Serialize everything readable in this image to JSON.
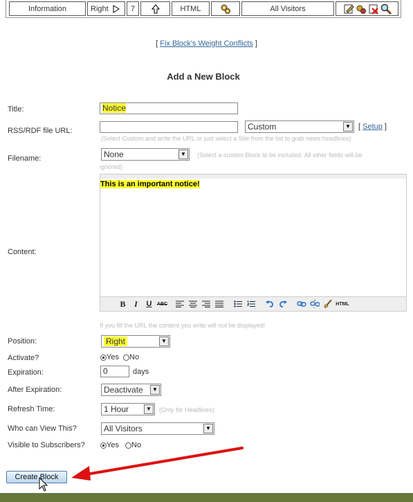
{
  "top_bar": {
    "information": "Information",
    "position": "Right",
    "weight": "7",
    "type": "HTML",
    "who": "All Visitors"
  },
  "fix_link": "Fix Block's Weight Conflicts",
  "heading": "Add a New Block",
  "fields": {
    "title_label": "Title:",
    "title_value": "Notice",
    "rss_label": "RSS/RDF file URL:",
    "rss_value": "",
    "rss_select": "Custom",
    "setup_link": "Setup",
    "rss_hint": "(Select Custom and write the URL or just select a Site from the list to grab news headlines)",
    "filename_label": "Filename:",
    "filename_value": "None",
    "filename_hint_1": "(Select a custom Block to be included. All other fields will be",
    "filename_hint_2": "ignored)",
    "content_label": "Content:",
    "content_value": "This is an important notice!",
    "content_hint": "If you fill the URL the content you write will not be displayed!",
    "position_label": "Position:",
    "position_value": "Right",
    "activate_label": "Activate?",
    "yes": "Yes",
    "no": "No",
    "expiration_label": "Expiration:",
    "expiration_value": "0",
    "expiration_unit": "days",
    "after_exp_label": "After Expiration:",
    "after_exp_value": "Deactivate",
    "refresh_label": "Refresh Time:",
    "refresh_value": "1 Hour",
    "refresh_hint": "(Only for Headlines)",
    "who_label": "Who can View This?",
    "who_value": "All Visitors",
    "visible_label": "Visible to Subscribers?"
  },
  "toolbar": {
    "bold": "B",
    "italic": "I",
    "underline": "U",
    "strike": "ABC",
    "html": "HTML"
  },
  "create_button": "Create Block",
  "colors": {
    "highlight": "#ffff33",
    "link": "#336699",
    "arrow": "#dd1111",
    "footer": "#66773b"
  }
}
